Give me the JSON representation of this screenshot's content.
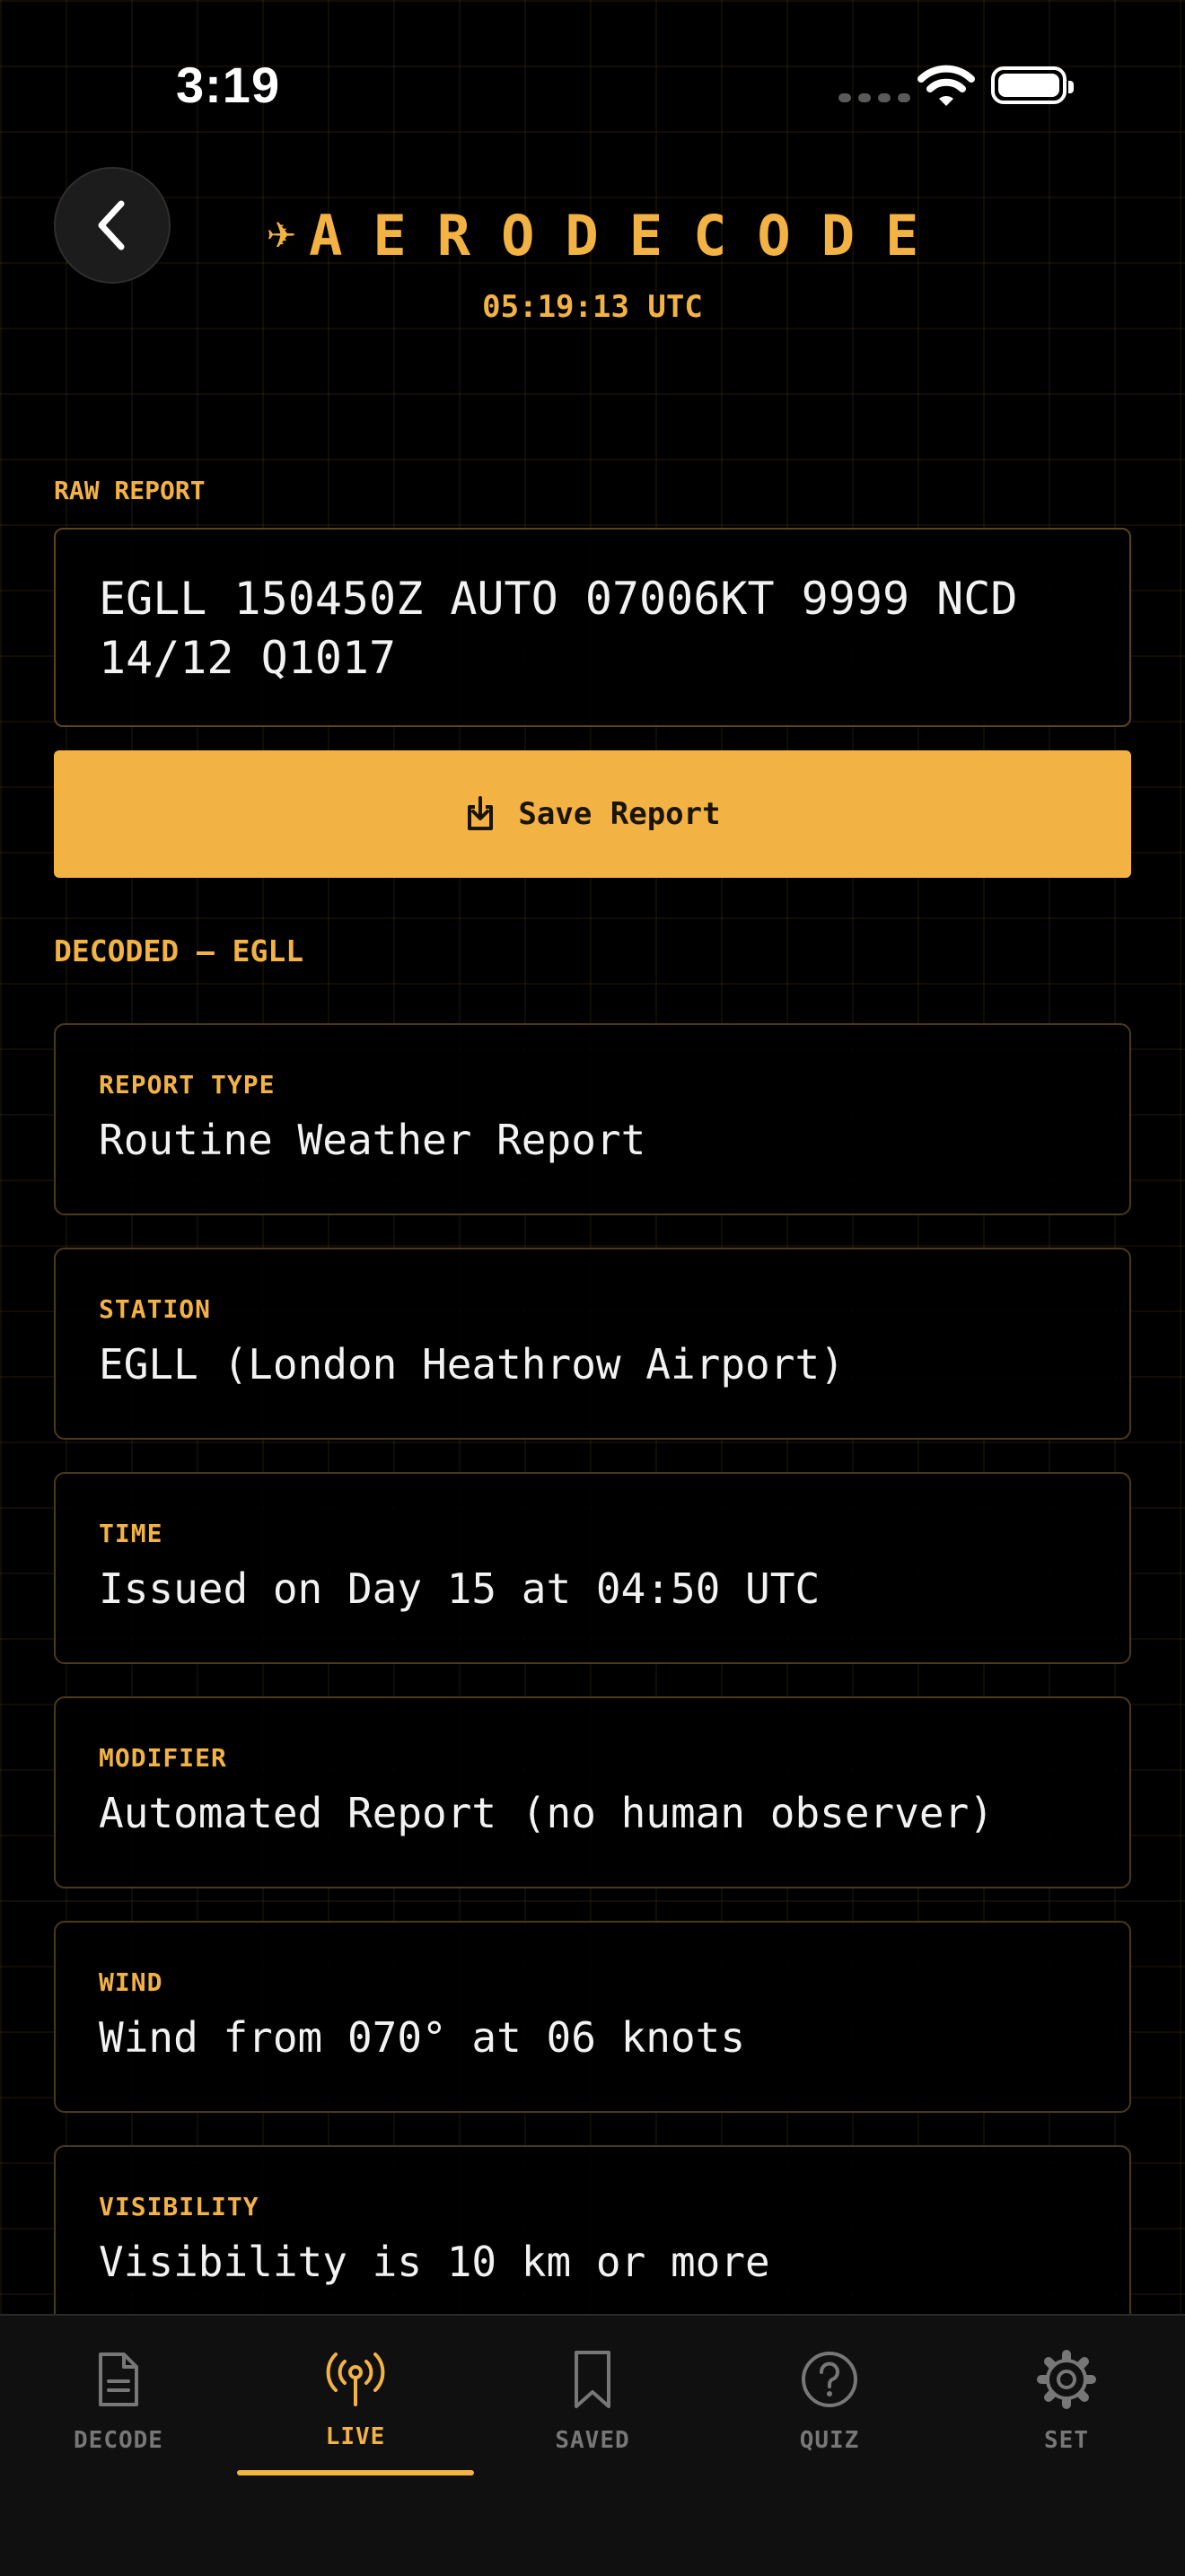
{
  "status_bar": {
    "time": "3:19"
  },
  "header": {
    "title": "AERODECODE",
    "utc_time": "05:19:13 UTC",
    "icons": {
      "back": "chevron-left-icon",
      "plane": "airplane-icon"
    }
  },
  "raw_report": {
    "label": "RAW REPORT",
    "text": "EGLL 150450Z AUTO 07006KT 9999 NCD 14/12 Q1017"
  },
  "save_button": {
    "label": "Save Report",
    "icon": "save-icon"
  },
  "decoded": {
    "label": "DECODED — EGLL",
    "items": [
      {
        "label": "REPORT TYPE",
        "value": "Routine Weather Report"
      },
      {
        "label": "STATION",
        "value": "EGLL (London Heathrow Airport)"
      },
      {
        "label": "TIME",
        "value": "Issued on Day 15 at 04:50 UTC"
      },
      {
        "label": "MODIFIER",
        "value": "Automated Report (no human observer)"
      },
      {
        "label": "WIND",
        "value": "Wind from 070° at 06 knots"
      },
      {
        "label": "VISIBILITY",
        "value": "Visibility is 10 km or more"
      }
    ]
  },
  "tabs": [
    {
      "label": "DECODE",
      "icon": "document-icon",
      "active": false
    },
    {
      "label": "LIVE",
      "icon": "antenna-icon",
      "active": true
    },
    {
      "label": "SAVED",
      "icon": "bookmark-icon",
      "active": false
    },
    {
      "label": "QUIZ",
      "icon": "question-icon",
      "active": false
    },
    {
      "label": "SET",
      "icon": "gear-icon",
      "active": false
    }
  ],
  "colors": {
    "accent": "#f3b244",
    "background": "#000000",
    "text": "#f2f2f2",
    "inactive": "#777777"
  }
}
